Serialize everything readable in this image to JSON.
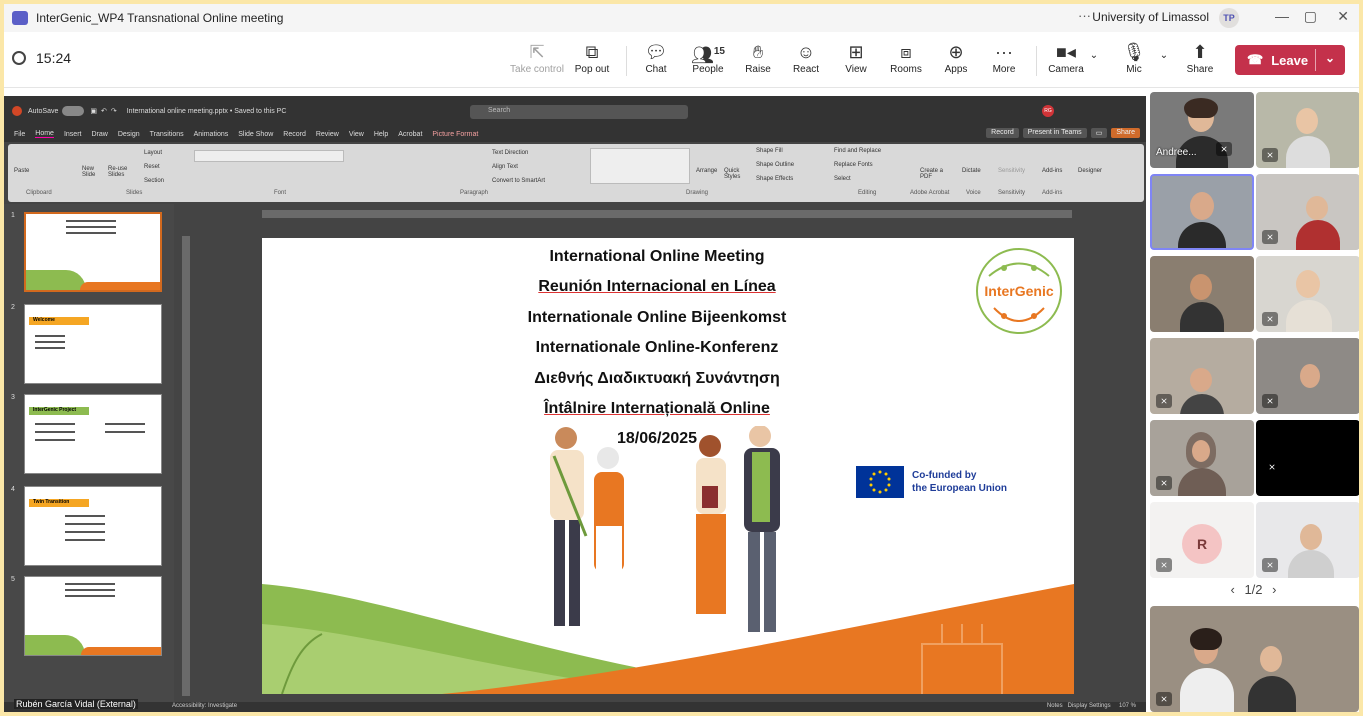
{
  "window": {
    "title": "InterGenic_WP4 Transnational Online meeting",
    "org": "University of Limassol",
    "avatar_initials": "TP",
    "more": "···",
    "minimize": "—",
    "restore": "▢",
    "close": "✕"
  },
  "toolbar": {
    "timer": "15:24",
    "take_control": "Take control",
    "pop_out": "Pop out",
    "chat": "Chat",
    "people": "People",
    "people_count": "15",
    "raise": "Raise",
    "react": "React",
    "view": "View",
    "rooms": "Rooms",
    "apps": "Apps",
    "more": "More",
    "camera": "Camera",
    "mic": "Mic",
    "share": "Share",
    "leave": "Leave"
  },
  "powerpoint": {
    "autosave": "AutoSave",
    "filename": "International online meeting.pptx • Saved to this PC",
    "search": "Search",
    "user_badge": "RG",
    "tabs": [
      "File",
      "Home",
      "Insert",
      "Draw",
      "Design",
      "Transitions",
      "Animations",
      "Slide Show",
      "Record",
      "Review",
      "View",
      "Help",
      "Acrobat",
      "Picture Format"
    ],
    "record_btn": "Record",
    "present_btn": "Present in Teams",
    "share_btn": "Share",
    "ribbon_groups": [
      "Clipboard",
      "Slides",
      "Font",
      "Paragraph",
      "Drawing",
      "Editing",
      "Adobe Acrobat",
      "Voice",
      "Sensitivity",
      "Add-ins"
    ],
    "ribbon_labels": {
      "paste": "Paste",
      "new_slide": "New Slide",
      "reuse": "Re-use Slides",
      "layout": "Layout",
      "reset": "Reset",
      "section": "Section",
      "text_direction": "Text Direction",
      "align_text": "Align Text",
      "smartart": "Convert to SmartArt",
      "arrange": "Arrange",
      "quick_styles": "Quick Styles",
      "shape_fill": "Shape Fill",
      "shape_outline": "Shape Outline",
      "shape_effects": "Shape Effects",
      "find_replace": "Find and Replace",
      "replace_fonts": "Replace Fonts",
      "select": "Select",
      "create_pdf": "Create a PDF",
      "dictate": "Dictate",
      "sensitivity": "Sensitivity",
      "addins": "Add-ins",
      "designer": "Designer"
    },
    "slide_numbers": [
      "1",
      "2",
      "3",
      "4",
      "5"
    ],
    "thumb2_title": "Welcome",
    "thumb3_title": "InterGenic Project",
    "thumb4_title": "Twin Transition",
    "status_accessibility": "Accessibility: Investigate",
    "status_notes": "Notes",
    "status_display": "Display Settings",
    "status_zoom": "107 %"
  },
  "slide": {
    "lines": [
      "International Online Meeting",
      "Reunión Internacional en Línea",
      "Internationale Online Bijeenkomst",
      "Internationale Online-Konferenz",
      "Διεθνής Διαδικτυακή Συνάντηση",
      "Întâlnire Internațională Online",
      "18/06/2025"
    ],
    "logo_text": "InterGenic",
    "eu_line1": "Co-funded by",
    "eu_line2": "the European Union"
  },
  "presenter": "Rubén García Vidal (External)",
  "gallery": {
    "tile1_name": "Andree...",
    "r_initial": "R",
    "pager": "1/2",
    "prev": "‹",
    "next": "›"
  },
  "colors": {
    "leave": "#c4314b",
    "frame": "#fbe7a8",
    "accent_orange": "#e87722",
    "accent_green": "#8dbb50"
  }
}
